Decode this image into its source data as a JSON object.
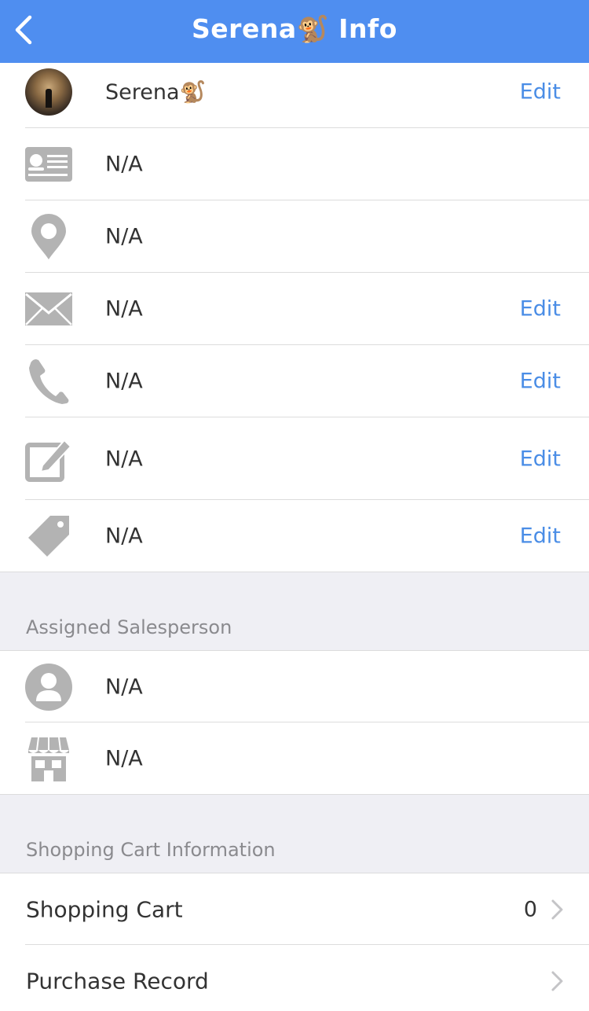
{
  "navbar": {
    "title": "Serena🐒 Info",
    "background": "#4f8ef0"
  },
  "profile": {
    "name": "Serena🐒",
    "edit_label": "Edit"
  },
  "info_rows": [
    {
      "icon": "id-card-icon",
      "value": "N/A"
    },
    {
      "icon": "location-pin-icon",
      "value": "N/A"
    },
    {
      "icon": "envelope-icon",
      "value": "N/A",
      "edit_label": "Edit"
    },
    {
      "icon": "phone-icon",
      "value": "N/A",
      "edit_label": "Edit"
    },
    {
      "icon": "note-edit-icon",
      "value": "N/A",
      "edit_label": "Edit"
    },
    {
      "icon": "tag-icon",
      "value": "N/A",
      "edit_label": "Edit"
    }
  ],
  "salesperson": {
    "header": "Assigned Salesperson",
    "rows": [
      {
        "icon": "person-icon",
        "value": "N/A"
      },
      {
        "icon": "store-icon",
        "value": "N/A"
      }
    ]
  },
  "cart_info": {
    "header": "Shopping Cart Information",
    "rows": [
      {
        "label": "Shopping Cart",
        "count": "0"
      },
      {
        "label": "Purchase Record"
      }
    ]
  },
  "colors": {
    "accent": "#4a8de6",
    "icon_gray": "#b3b3b3",
    "section_bg": "#efeff4"
  }
}
